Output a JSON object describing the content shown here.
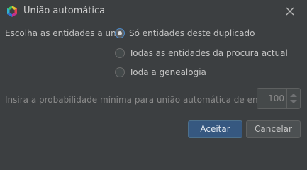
{
  "window": {
    "title": "União automática",
    "icon": "app-hexagon-icon",
    "close_icon": "close-icon"
  },
  "form": {
    "choose_label": "Escolha as entidades a unir",
    "options": [
      {
        "label": "Só entidades deste duplicado",
        "selected": true
      },
      {
        "label": "Todas as entidades da procura actual",
        "selected": false
      },
      {
        "label": "Toda a genealogia",
        "selected": false
      }
    ],
    "probability_label": "Insira a probabilidade mínima para união automática de entidades",
    "probability_value": "100"
  },
  "buttons": {
    "ok": "Aceitar",
    "cancel": "Cancelar"
  },
  "colors": {
    "background": "#3c3f41",
    "primary_button": "#365880",
    "radio_focus": "#4a88c7"
  }
}
